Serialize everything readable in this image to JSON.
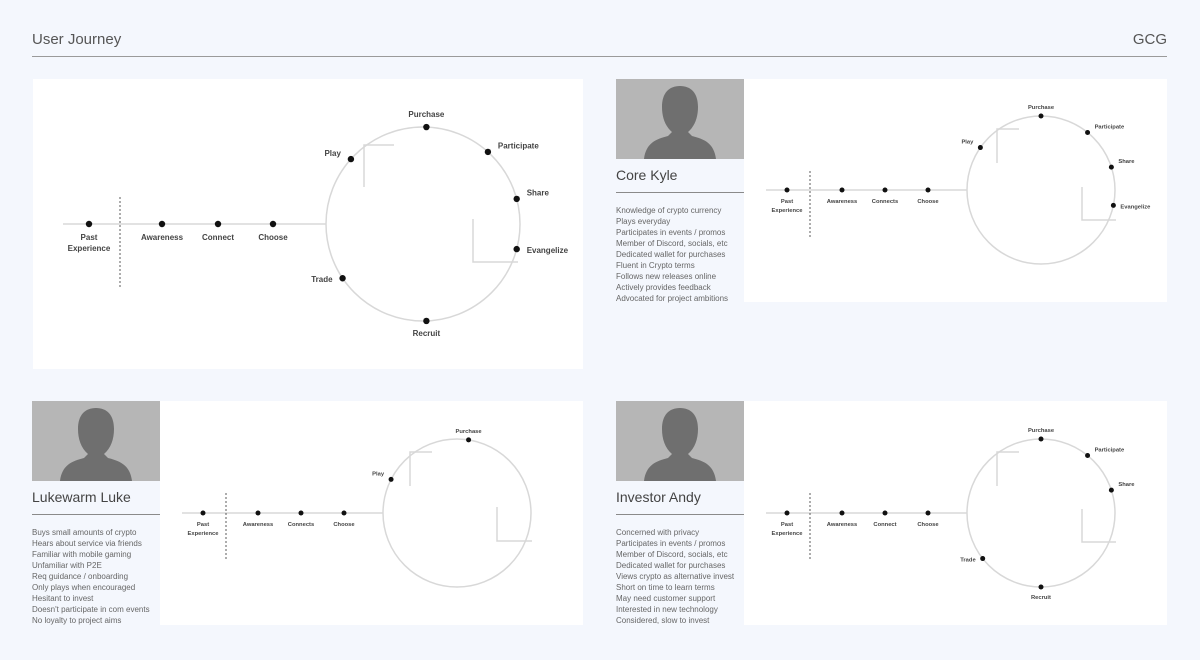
{
  "header": {
    "title": "User Journey",
    "brand": "GCG"
  },
  "colors": {
    "background": "#f4f7fd",
    "panel": "#ffffff",
    "avatar": "#b6b6b6",
    "silhouette": "#6f6f6f",
    "track": "#d8d8d8",
    "dot": "#111111"
  },
  "diagrams": [
    {
      "id": "main",
      "linear": [
        "Past Experience",
        "Awareness",
        "Connect",
        "Choose"
      ],
      "circle": [
        "Purchase",
        "Participate",
        "Share",
        "Evangelize",
        "Recruit",
        "Trade",
        "Play"
      ]
    },
    {
      "id": "core-kyle",
      "linear": [
        "Past Experience",
        "Awareness",
        "Connects",
        "Choose"
      ],
      "circle": [
        "Purchase",
        "Participate",
        "Share",
        "Evangelize",
        "Play"
      ]
    },
    {
      "id": "lukewarm-luke",
      "linear": [
        "Past Experience",
        "Awareness",
        "Connects",
        "Choose"
      ],
      "circle": [
        "Purchase",
        "Play"
      ]
    },
    {
      "id": "investor-andy",
      "linear": [
        "Past Experience",
        "Awareness",
        "Connect",
        "Choose"
      ],
      "circle": [
        "Purchase",
        "Participate",
        "Share",
        "Recruit",
        "Trade"
      ]
    }
  ],
  "personas": [
    {
      "name": "Core Kyle",
      "traits": [
        "Knowledge of crypto currency",
        "Plays everyday",
        "Participates in events / promos",
        "Member of Discord, socials, etc",
        "Dedicated wallet for purchases",
        "Fluent in Crypto terms",
        "Follows new releases online",
        "Actively provides feedback",
        "Advocated for project ambitions"
      ]
    },
    {
      "name": "Lukewarm Luke",
      "traits": [
        "Buys small amounts of crypto",
        "Hears about service via friends",
        "Familiar with mobile gaming",
        "Unfamiliar with P2E",
        "Req guidance / onboarding",
        "Only plays when encouraged",
        "Hesitant to invest",
        "Doesn't participate in com events",
        "No loyalty to project aims"
      ]
    },
    {
      "name": "Investor Andy",
      "traits": [
        "Concerned with privacy",
        "Participates in events / promos",
        "Member of Discord, socials, etc",
        "Dedicated wallet for purchases",
        "Views crypto as alternative invest",
        "Short on time to learn terms",
        "May need customer support",
        "Interested in new technology",
        "Considered, slow to invest"
      ]
    }
  ]
}
